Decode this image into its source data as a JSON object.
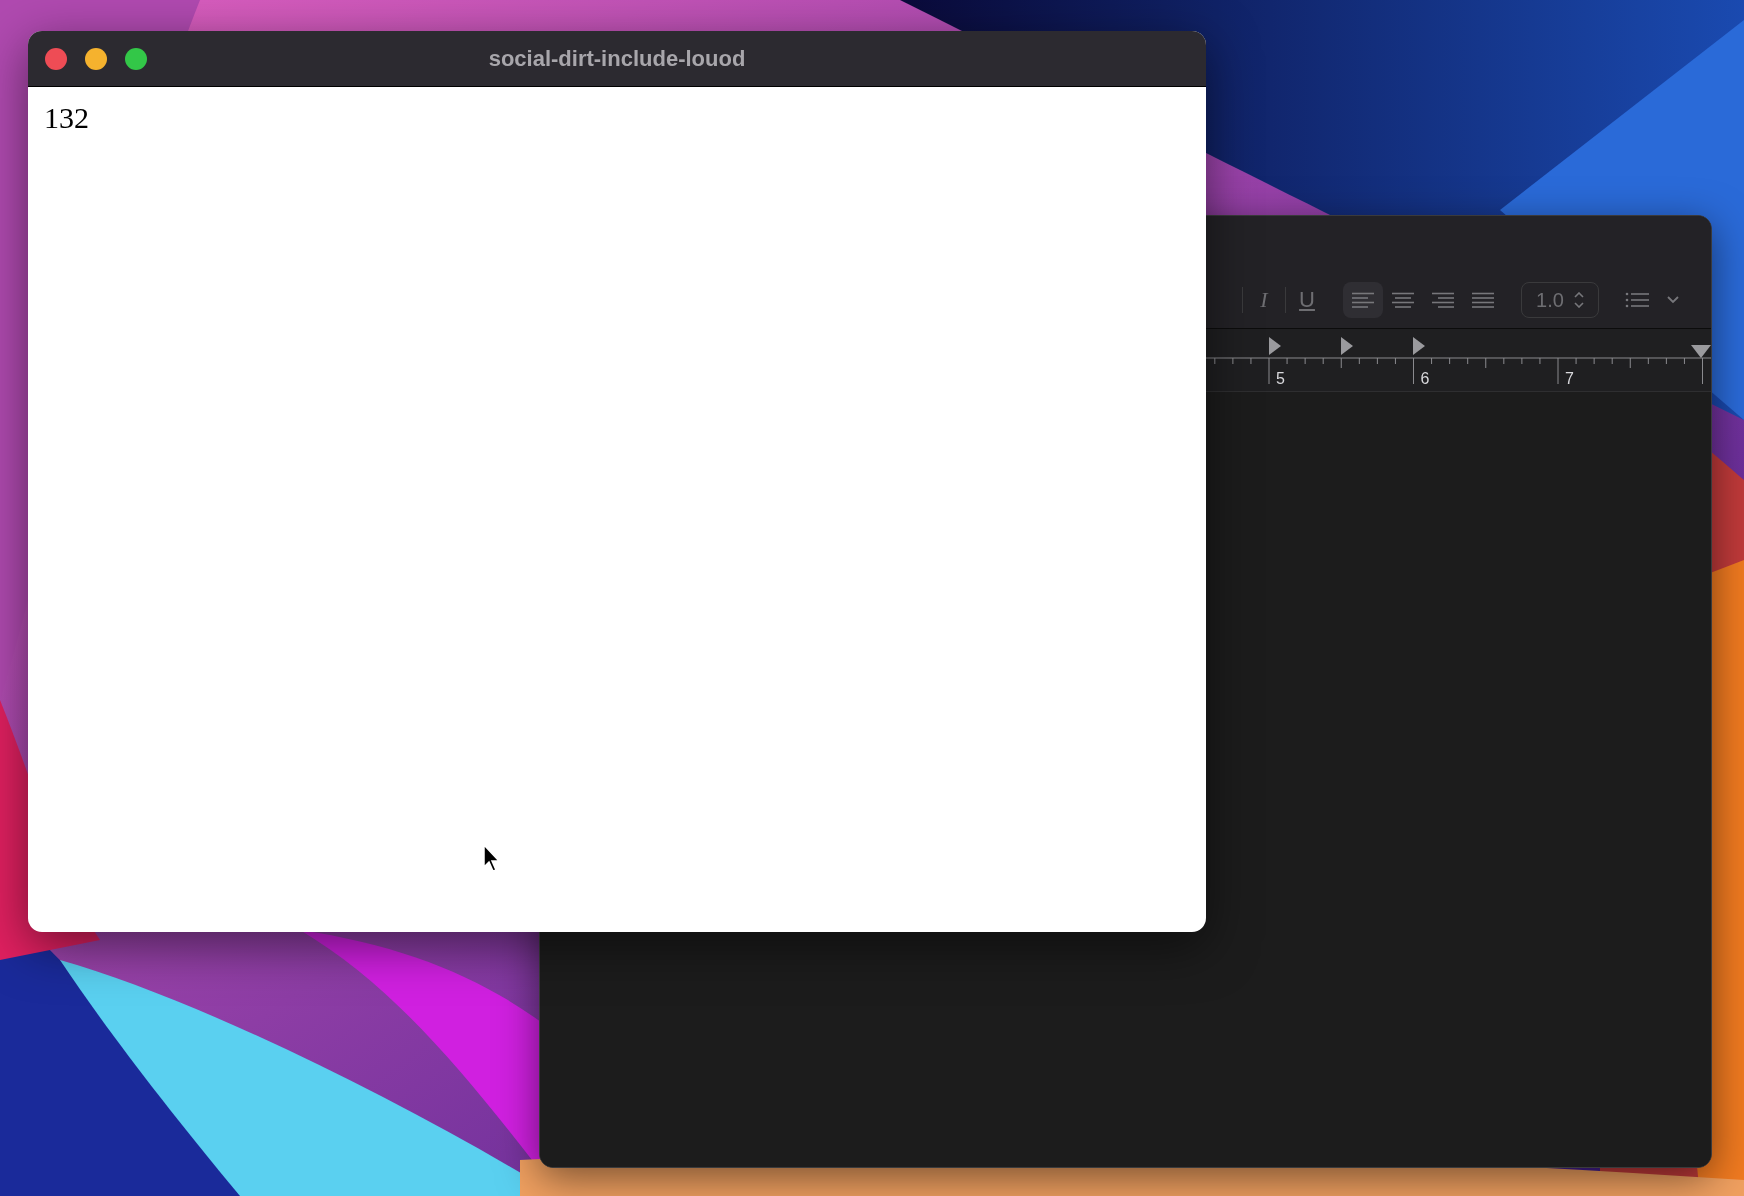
{
  "front_window": {
    "title": "social-dirt-include-louod",
    "content": "132"
  },
  "back_window": {
    "toolbar": [
      {
        "kind": "italic",
        "label": "I"
      },
      {
        "kind": "underline",
        "label": "U"
      },
      {
        "kind": "align-left",
        "selected": true
      },
      {
        "kind": "align-center",
        "selected": false
      },
      {
        "kind": "align-right",
        "selected": false
      },
      {
        "kind": "align-justify",
        "selected": false
      },
      {
        "kind": "spacing",
        "value": "1.0"
      },
      {
        "kind": "list"
      }
    ],
    "ruler": {
      "labels": [
        "5",
        "6",
        "7"
      ]
    }
  }
}
